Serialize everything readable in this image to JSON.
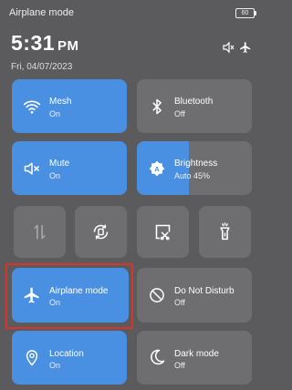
{
  "status": {
    "title": "Airplane mode",
    "battery": "60"
  },
  "clock": {
    "time": "5:31",
    "ampm": "PM",
    "date": "Fri, 04/07/2023"
  },
  "tiles": [
    {
      "label": "Mesh",
      "state": "On",
      "icon": "wifi-icon",
      "active": true
    },
    {
      "label": "Bluetooth",
      "state": "Off",
      "icon": "bluetooth-icon",
      "active": false
    },
    {
      "label": "Mute",
      "state": "On",
      "icon": "mute-icon",
      "active": true
    },
    {
      "label": "Brightness",
      "state": "Auto 45%",
      "icon": "brightness-icon",
      "active": true,
      "level": 0.45
    },
    {
      "label": "Airplane mode",
      "state": "On",
      "icon": "airplane-icon",
      "active": true
    },
    {
      "label": "Do Not Disturb",
      "state": "Off",
      "icon": "do-not-disturb-icon",
      "active": false
    },
    {
      "label": "Location",
      "state": "On",
      "icon": "location-icon",
      "active": true
    },
    {
      "label": "Dark mode",
      "state": "Off",
      "icon": "dark-mode-icon",
      "active": false
    }
  ],
  "small_tiles": [
    "data-transfer-icon",
    "auto-rotate-icon",
    "screenshot-icon",
    "flashlight-icon"
  ],
  "colors": {
    "active": "#4a90e2",
    "inactive": "#6e6e71",
    "highlight": "#d8342c"
  }
}
